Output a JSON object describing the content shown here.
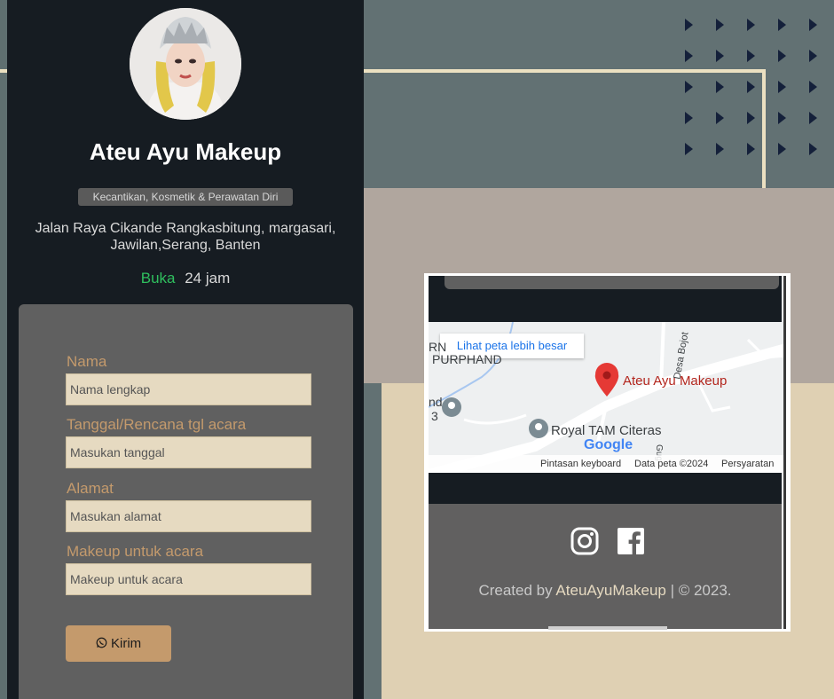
{
  "profile": {
    "name": "Ateu Ayu Makeup",
    "category": "Kecantikan, Kosmetik & Perawatan Diri",
    "address": "Jalan Raya Cikande Rangkasbitung, margasari, Jawilan,Serang, Banten",
    "status_open": "Buka",
    "hours": "24 jam"
  },
  "form": {
    "name_label": "Nama",
    "name_placeholder": "Nama lengkap",
    "date_label": "Tanggal/Rencana tgl acara",
    "date_placeholder": "Masukan tanggal",
    "address_label": "Alamat",
    "address_placeholder": "Masukan alamat",
    "event_label": "Makeup untuk acara",
    "event_placeholder": "Makeup untuk acara",
    "submit_label": "Kirim"
  },
  "map": {
    "larger_map_link": "Lihat peta lebih besar",
    "pin_label": "Ateu Ayu Makeup",
    "poi_label": "Royal TAM Citeras",
    "road_label": "Desa Bojot",
    "edge_label_top": "RN",
    "edge_label_2": "PURPHAND",
    "edge_label_3": "nd",
    "edge_label_4": "3",
    "road_label_2": "Gug",
    "google": "Google",
    "footer": {
      "shortcuts": "Pintasan keyboard",
      "data": "Data peta ©2024",
      "terms": "Persyaratan"
    }
  },
  "footer": {
    "instagram_icon": "instagram-icon",
    "facebook_icon": "facebook-icon",
    "credit_prefix": "Created by",
    "credit_brand": "AteuAyuMakeup",
    "credit_suffix": "| © 2023."
  },
  "colors": {
    "accent": "#c49a6c",
    "dark_panel": "#161c22",
    "cream": "#e6dac1",
    "open_green": "#2fbf5e"
  }
}
